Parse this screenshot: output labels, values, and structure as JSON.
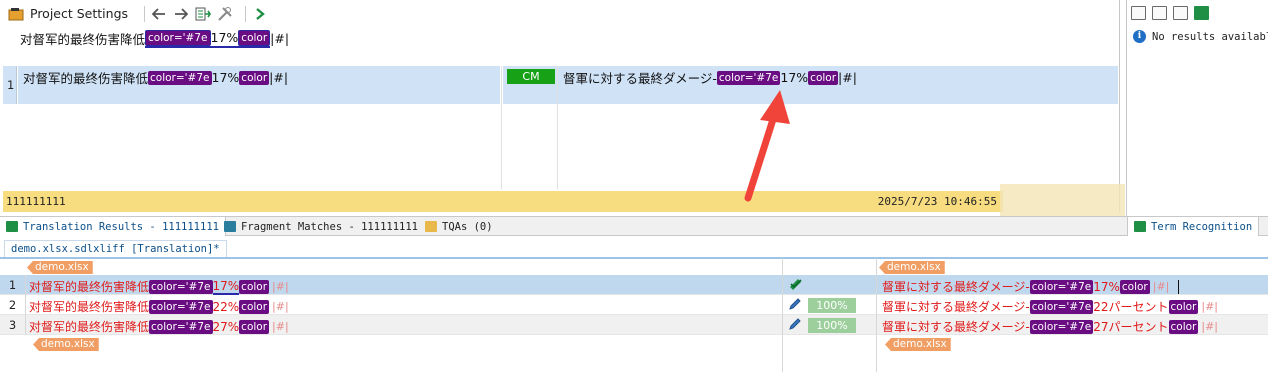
{
  "toolbar": {
    "title": "Project Settings"
  },
  "source_line": {
    "text_before": "对督军的最终伤害降低",
    "tag_open": "color='#7e",
    "value": "17%",
    "tag_close": "color",
    "suffix": "|#|"
  },
  "segment_grid": {
    "row_number": "1",
    "source": {
      "text": "对督军的最终伤害降低",
      "tag_open": "color='#7e",
      "value": "17%",
      "tag_close": "color",
      "suffix": "|#|"
    },
    "status": "CM",
    "target": {
      "text": "督軍に対する最終ダメージ-",
      "tag_open": "color='#7e",
      "value": "17%",
      "tag_close": "color",
      "suffix": "|#|"
    }
  },
  "status_bar": {
    "left": "111111111",
    "timestamp": "2025/7/23 10:46:55"
  },
  "right_panel": {
    "message": "No results availabl"
  },
  "tabs": [
    {
      "label": "Translation Results - 111111111",
      "active": true
    },
    {
      "label": "Fragment Matches - 111111111",
      "active": false
    },
    {
      "label": "TQAs (0)",
      "active": false
    },
    {
      "label": "Term Recognition",
      "active": false
    }
  ],
  "editor": {
    "document_tab": "demo.xlsx.sdlxliff [Translation]*",
    "file_tag": "demo.xlsx",
    "rows": [
      {
        "num": "1",
        "src_text": "对督军的最终伤害降低",
        "src_tag_open": "color='#7e",
        "src_value": "17%",
        "src_tag_close": "color",
        "match": "",
        "tgt_text": "督軍に対する最終ダメージ-",
        "tgt_tag_open": "color='#7e",
        "tgt_value": "17%",
        "tgt_value_suffix": "",
        "tgt_tag_close": "color"
      },
      {
        "num": "2",
        "src_text": "对督军的最终伤害降低",
        "src_tag_open": "color='#7e",
        "src_value": "22%",
        "src_tag_close": "color",
        "match": "100%",
        "tgt_text": "督軍に対する最終ダメージ-",
        "tgt_tag_open": "color='#7e",
        "tgt_value": "22",
        "tgt_value_suffix": "パーセント",
        "tgt_tag_close": "color"
      },
      {
        "num": "3",
        "src_text": "对督军的最终伤害降低",
        "src_tag_open": "color='#7e",
        "src_value": "27%",
        "src_tag_close": "color",
        "match": "100%",
        "tgt_text": "督軍に対する最終ダメージ-",
        "tgt_tag_open": "color='#7e",
        "tgt_value": "27",
        "tgt_value_suffix": "パーセント",
        "tgt_tag_close": "color"
      }
    ],
    "pipe": "|#|"
  },
  "colors": {
    "tag_purple": "#6a0d83",
    "cm_green": "#17a117",
    "status_yellow": "#f7dc80",
    "error_red": "#e01a1a",
    "arrow_red": "#f0443a",
    "file_tag_orange": "#f09e64"
  }
}
